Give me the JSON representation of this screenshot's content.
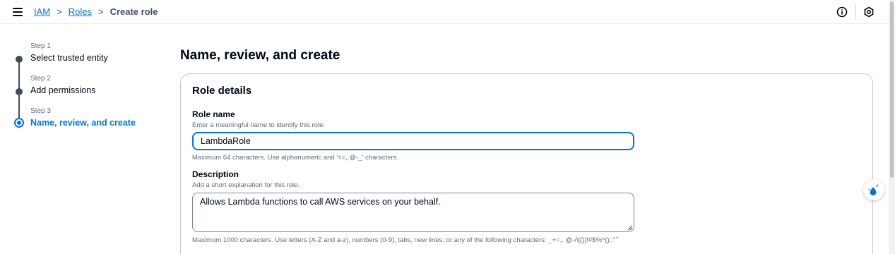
{
  "breadcrumb": {
    "items": [
      "IAM",
      "Roles"
    ],
    "current": "Create role",
    "separator": ">"
  },
  "wizard": {
    "steps": [
      {
        "number": "Step 1",
        "title": "Select trusted entity"
      },
      {
        "number": "Step 2",
        "title": "Add permissions"
      },
      {
        "number": "Step 3",
        "title": "Name, review, and create"
      }
    ],
    "active_step": 3
  },
  "page": {
    "title": "Name, review, and create"
  },
  "role_details": {
    "title": "Role details",
    "role_name": {
      "label": "Role name",
      "hint": "Enter a meaningful name to identify this role.",
      "value": "LambdaRole",
      "constraint": "Maximum 64 characters. Use alphanumeric and '+=,.@-_' characters."
    },
    "description": {
      "label": "Description",
      "hint": "Add a short explanation for this role.",
      "value": "Allows Lambda functions to call AWS services on your behalf.",
      "constraint": "Maximum 1000 characters. Use letters (A-Z and a-z), numbers (0-9), tabs, new lines, or any of the following characters: _+=,. @-/\\[{}]!#$%^();:'\"`"
    }
  },
  "icons": {
    "menu": "hamburger-menu-icon",
    "info": "info-icon",
    "settings": "settings-icon",
    "assistant": "assistant-sparkle-icon"
  },
  "colors": {
    "accent": "#0972d3",
    "text": "#000716",
    "muted": "#5f6b7a",
    "step_inactive": "#414d5c"
  }
}
